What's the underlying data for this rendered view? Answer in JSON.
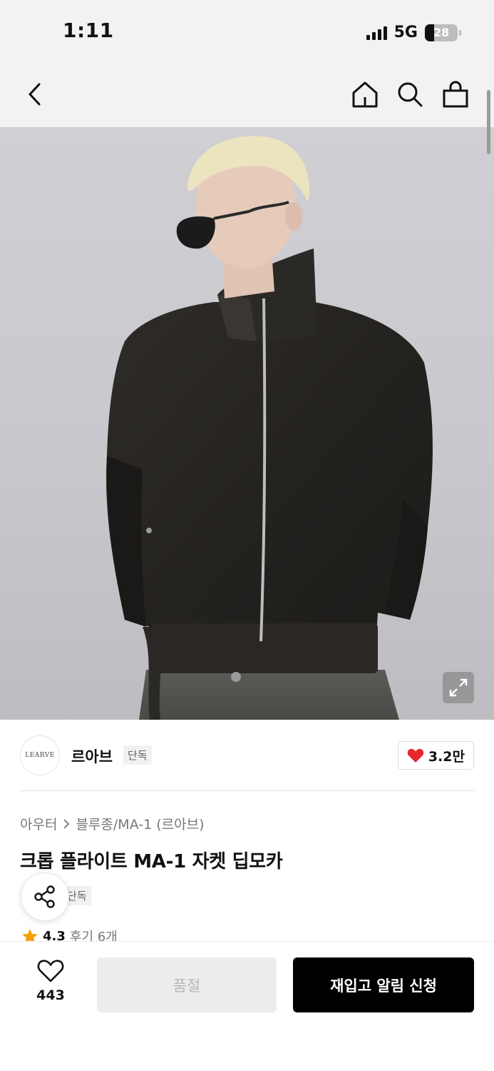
{
  "status_bar": {
    "time": "1:11",
    "network": "5G",
    "battery": "28",
    "battery_level": 0.28
  },
  "nav": {
    "back_icon": "chevron-left-icon",
    "home_icon": "home-icon",
    "search_icon": "search-icon",
    "cart_icon": "shopping-bag-icon"
  },
  "hero": {
    "expand_icon": "expand-icon"
  },
  "brand": {
    "logo_text": "LEARVE",
    "name": "르아브",
    "tag": "단독",
    "likes": "3.2만"
  },
  "product": {
    "breadcrumb": [
      "아우터",
      "블루종/MA-1 (르아브)"
    ],
    "title": "크롭 플라이트 MA-1 자켓 딥모카",
    "tag": "단독",
    "rating": "4.3",
    "reviews": "후기 6개"
  },
  "bottom": {
    "wish_count": "443",
    "soldout_label": "품절",
    "restock_label": "재입고 알림 신청"
  },
  "colors": {
    "accent_black": "#000000",
    "heart_red": "#e8262f",
    "star_orange": "#f5a000"
  }
}
